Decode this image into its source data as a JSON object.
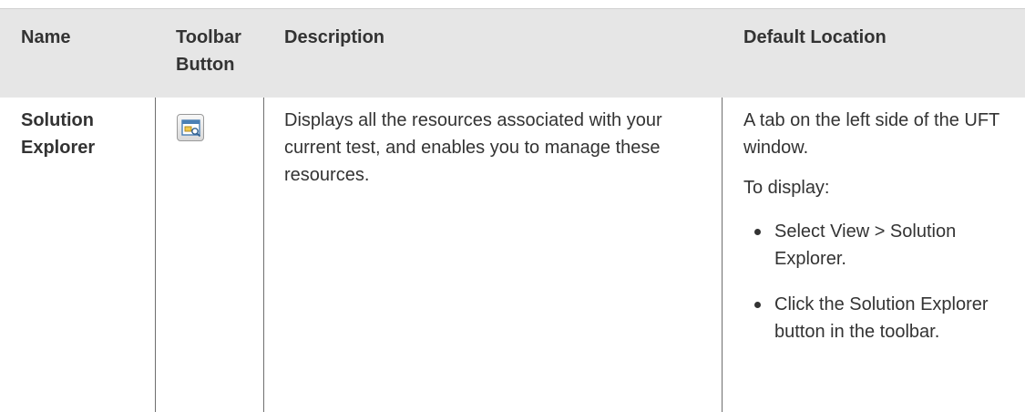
{
  "table": {
    "headers": {
      "name": "Name",
      "toolbar_button": "Toolbar Button",
      "description": "Description",
      "default_location": "Default Location"
    },
    "rows": [
      {
        "name": "Solution Explorer",
        "toolbar_icon": "solution-explorer-icon",
        "description": "Displays all the resources associated with your current test, and enables you to manage these resources.",
        "location_intro": "A tab on the left side of the UFT window.",
        "location_display_label": "To display:",
        "location_steps": [
          "Select View > Solution Explorer.",
          "Click the Solution Explorer button in the toolbar."
        ]
      }
    ]
  }
}
